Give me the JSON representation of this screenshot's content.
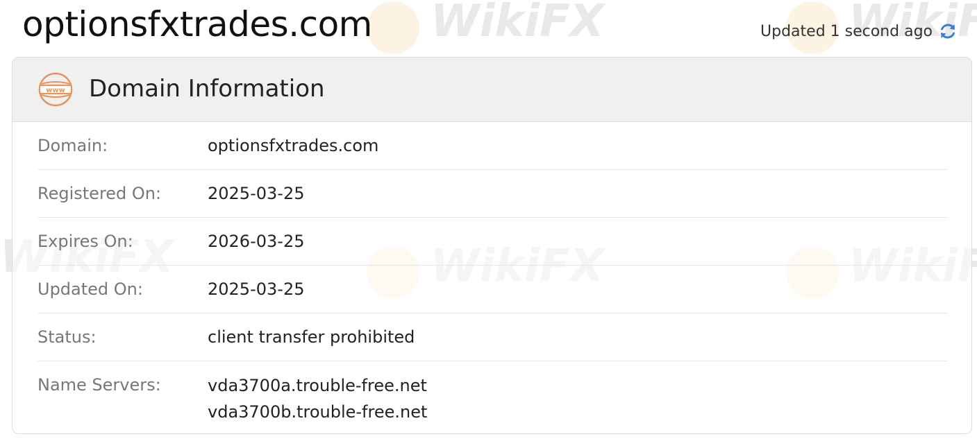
{
  "header": {
    "site_title": "optionsfxtrades.com",
    "updated_text": "Updated 1 second ago",
    "refresh_icon": "refresh-icon"
  },
  "card": {
    "icon": "www-globe-icon",
    "title": "Domain Information",
    "rows": [
      {
        "label": "Domain:",
        "value": "optionsfxtrades.com"
      },
      {
        "label": "Registered On:",
        "value": "2025-03-25"
      },
      {
        "label": "Expires On:",
        "value": "2026-03-25"
      },
      {
        "label": "Updated On:",
        "value": "2025-03-25"
      },
      {
        "label": "Status:",
        "value": "client transfer prohibited"
      }
    ],
    "name_servers": {
      "label": "Name Servers:",
      "values": [
        "vda3700a.trouble-free.net",
        "vda3700b.trouble-free.net"
      ]
    }
  },
  "watermark": {
    "text": "WikiFX"
  },
  "colors": {
    "accent_orange": "#e8935a",
    "refresh_blue": "#3b7dd8",
    "header_bg": "#f0f0f0"
  }
}
